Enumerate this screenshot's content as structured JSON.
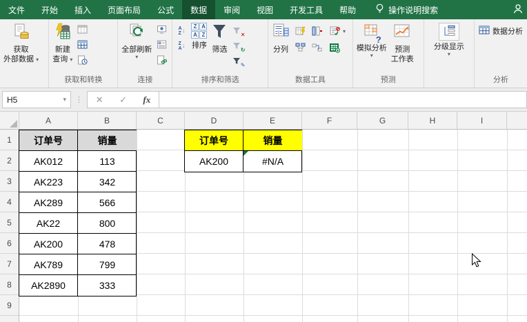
{
  "tab_bar": {
    "tabs": [
      "文件",
      "开始",
      "插入",
      "页面布局",
      "公式",
      "数据",
      "审阅",
      "视图",
      "开发工具",
      "帮助"
    ],
    "active_tab": "数据",
    "search_label": "操作说明搜索"
  },
  "ribbon": {
    "get_external_line1": "获取",
    "get_external_line2": "外部数据",
    "new_query_line1": "新建",
    "new_query_line2": "查询",
    "get_transform_group": "获取和转换",
    "refresh_all": "全部刷新",
    "connections_group": "连接",
    "sort": "排序",
    "filter": "筛选",
    "sort_filter_group": "排序和筛选",
    "text_to_columns": "分列",
    "data_tools_group": "数据工具",
    "what_if": "模拟分析",
    "forecast_sheet_line1": "预测",
    "forecast_sheet_line2": "工作表",
    "forecast_group": "预测",
    "outline": "分级显示",
    "data_analysis": "数据分析",
    "analysis_group": "分析"
  },
  "glyphs": {
    "dropdown": "▾",
    "dots": "⋮",
    "cancel": "✕",
    "enter": "✓",
    "fx": "fx",
    "sort_a": "A",
    "sort_z": "Z",
    "arrow_down": "↓",
    "question": "?",
    "x_small": "✕",
    "refresh_small": "↻",
    "pencil_small": "✎"
  },
  "formula_bar": {
    "name_box": "H5",
    "formula": ""
  },
  "grid": {
    "column_headers": [
      "A",
      "B",
      "C",
      "D",
      "E",
      "F",
      "G",
      "H",
      "I"
    ],
    "row_headers": [
      "1",
      "2",
      "3",
      "4",
      "5",
      "6",
      "7",
      "8",
      "9"
    ],
    "source_table": {
      "header": [
        "订单号",
        "销量"
      ],
      "rows": [
        [
          "AK012",
          "113"
        ],
        [
          "AK223",
          "342"
        ],
        [
          "AK289",
          "566"
        ],
        [
          "AK22",
          "800"
        ],
        [
          "AK200",
          "478"
        ],
        [
          "AK789",
          "799"
        ],
        [
          "AK2890",
          "333"
        ]
      ]
    },
    "lookup_table": {
      "header": [
        "订单号",
        "销量"
      ],
      "rows": [
        [
          "AK200",
          "#N/A"
        ]
      ]
    }
  }
}
